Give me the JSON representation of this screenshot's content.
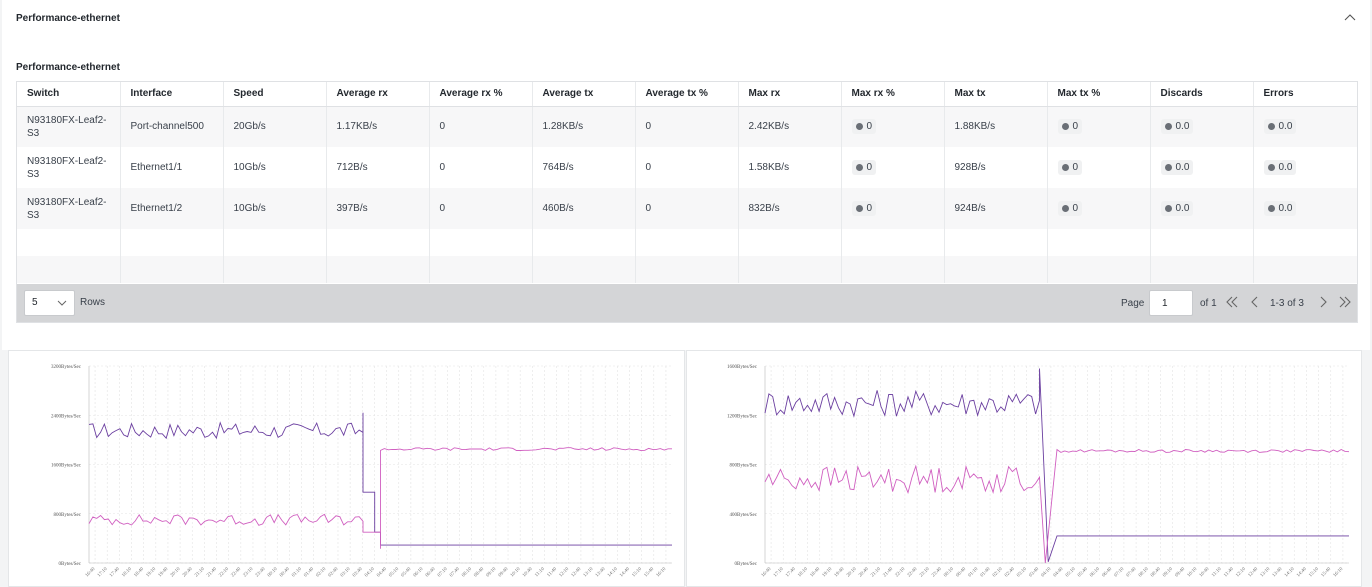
{
  "panel": {
    "title": "Performance-ethernet",
    "section_title": "Performance-ethernet"
  },
  "table": {
    "columns": [
      "Switch",
      "Interface",
      "Speed",
      "Average rx",
      "Average rx %",
      "Average tx",
      "Average tx %",
      "Max rx",
      "Max rx %",
      "Max tx",
      "Max tx %",
      "Discards",
      "Errors"
    ],
    "rows": [
      {
        "switch": "N93180FX-Leaf2-S3",
        "interface": "Port-channel500",
        "speed": "20Gb/s",
        "avg_rx": "1.17KB/s",
        "avg_rx_pct": "0",
        "avg_tx": "1.28KB/s",
        "avg_tx_pct": "0",
        "max_rx": "2.42KB/s",
        "max_rx_pct": "0",
        "max_tx": "1.88KB/s",
        "max_tx_pct": "0",
        "discards": "0.0",
        "errors": "0.0"
      },
      {
        "switch": "N93180FX-Leaf2-S3",
        "interface": "Ethernet1/1",
        "speed": "10Gb/s",
        "avg_rx": "712B/s",
        "avg_rx_pct": "0",
        "avg_tx": "764B/s",
        "avg_tx_pct": "0",
        "max_rx": "1.58KB/s",
        "max_rx_pct": "0",
        "max_tx": "928B/s",
        "max_tx_pct": "0",
        "discards": "0.0",
        "errors": "0.0"
      },
      {
        "switch": "N93180FX-Leaf2-S3",
        "interface": "Ethernet1/2",
        "speed": "10Gb/s",
        "avg_rx": "397B/s",
        "avg_rx_pct": "0",
        "avg_tx": "460B/s",
        "avg_tx_pct": "0",
        "max_rx": "832B/s",
        "max_rx_pct": "0",
        "max_tx": "924B/s",
        "max_tx_pct": "0",
        "discards": "0.0",
        "errors": "0.0"
      }
    ]
  },
  "pager": {
    "rows_value": "5",
    "rows_label": "Rows",
    "page_label": "Page",
    "page_value": "1",
    "of_label": "of 1",
    "range_label": "1-3 of 3"
  },
  "colors": {
    "series_purple": "#6b3fa0",
    "series_magenta": "#d05fc0",
    "grid": "#e3e3e3"
  },
  "chart_data": [
    {
      "type": "line",
      "y_ticks": [
        "0Bytes/Sec",
        "800Bytes/Sec",
        "1600Bytes/Sec",
        "2400Bytes/Sec",
        "3200Bytes/Sec"
      ],
      "ylim": [
        0,
        3200
      ],
      "x_ticks": [
        "16:40",
        "17:10",
        "17:40",
        "18:10",
        "18:40",
        "19:10",
        "19:40",
        "20:10",
        "20:40",
        "21:10",
        "21:40",
        "22:10",
        "22:40",
        "23:10",
        "23:40",
        "00:10",
        "00:40",
        "01:10",
        "01:40",
        "02:10",
        "02:40",
        "03:10",
        "03:40",
        "04:10",
        "04:40",
        "05:10",
        "05:40",
        "06:10",
        "06:40",
        "07:10",
        "07:40",
        "08:10",
        "08:40",
        "09:10",
        "09:40",
        "10:10",
        "10:40",
        "11:10",
        "11:40",
        "12:10",
        "12:40",
        "13:10",
        "13:40",
        "14:10",
        "14:40",
        "15:10",
        "15:40",
        "16:10"
      ],
      "grid": true,
      "series": [
        {
          "color": "purple",
          "segments": [
            {
              "x_start": 0,
              "x_end": 0.47,
              "mean": 2150,
              "amp": 130
            },
            {
              "spike": {
                "x": 0.47,
                "value": 2440
              }
            },
            {
              "x_start": 0.47,
              "x_end": 0.49,
              "value": 1150
            },
            {
              "x_start": 0.49,
              "x_end": 0.5,
              "value": 500
            },
            {
              "x_start": 0.5,
              "x_end": 1.0,
              "value": 290
            }
          ]
        },
        {
          "color": "magenta",
          "segments": [
            {
              "x_start": 0,
              "x_end": 0.47,
              "mean": 700,
              "amp": 90
            },
            {
              "x_start": 0.47,
              "x_end": 0.5,
              "value": 500
            },
            {
              "dip": {
                "x": 0.5,
                "value": 230
              }
            },
            {
              "x_start": 0.5,
              "x_end": 1.0,
              "mean": 1850,
              "amp": 25
            }
          ]
        }
      ]
    },
    {
      "type": "line",
      "y_ticks": [
        "0Bytes/Sec",
        "400Bytes/Sec",
        "800Bytes/Sec",
        "1200Bytes/Sec",
        "1600Bytes/Sec"
      ],
      "ylim": [
        0,
        1600
      ],
      "x_ticks": [
        "16:40",
        "17:10",
        "17:40",
        "18:10",
        "18:40",
        "19:10",
        "19:40",
        "20:10",
        "20:40",
        "21:10",
        "21:40",
        "22:10",
        "22:40",
        "23:10",
        "23:40",
        "00:10",
        "00:40",
        "01:10",
        "01:40",
        "02:10",
        "02:40",
        "03:10",
        "03:40",
        "04:10",
        "04:40",
        "05:10",
        "05:40",
        "06:10",
        "06:40",
        "07:10",
        "07:40",
        "08:10",
        "08:40",
        "09:10",
        "09:40",
        "10:10",
        "10:40",
        "11:10",
        "11:40",
        "12:10",
        "12:40",
        "13:10",
        "13:40",
        "14:10",
        "14:40",
        "15:10",
        "15:40",
        "16:10"
      ],
      "grid": true,
      "series": [
        {
          "color": "purple",
          "segments": [
            {
              "x_start": 0,
              "x_end": 0.47,
              "mean": 1300,
              "amp": 110
            },
            {
              "spike": {
                "x": 0.47,
                "value": 1580
              }
            },
            {
              "dip": {
                "x": 0.485,
                "value": 10
              }
            },
            {
              "x_start": 0.5,
              "x_end": 1.0,
              "value": 220
            }
          ]
        },
        {
          "color": "magenta",
          "segments": [
            {
              "x_start": 0,
              "x_end": 0.47,
              "mean": 680,
              "amp": 110
            },
            {
              "dip": {
                "x": 0.48,
                "value": 0
              }
            },
            {
              "x_start": 0.5,
              "x_end": 1.0,
              "mean": 910,
              "amp": 12
            }
          ]
        }
      ]
    }
  ]
}
